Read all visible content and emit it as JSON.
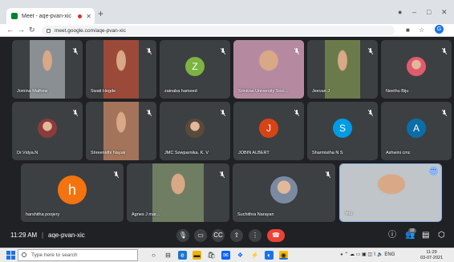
{
  "browser": {
    "tab_title": "Meet - aqe-pvan-xic",
    "new_tab_symbol": "+",
    "url": "meet.google.com/aqe-pvan-xic",
    "profile_initial": "G"
  },
  "participants": [
    {
      "name": "Jomina Mathew",
      "kind": "photo",
      "bg": "#8a8f93"
    },
    {
      "name": "Swati Hegde",
      "kind": "photo",
      "bg": "#9b4a3a"
    },
    {
      "name": "zainaba hameed",
      "kind": "initial",
      "initial": "Z",
      "color": "#7cb342"
    },
    {
      "name": "Srinivas University Soci...",
      "kind": "photo",
      "bg": "#b58aa0"
    },
    {
      "name": "Jeevan J",
      "kind": "photo",
      "bg": "#6b7a4a"
    },
    {
      "name": "Neethu Biju",
      "kind": "photo-circle",
      "bg": "#e05b6e"
    },
    {
      "name": "Dr.Vidya.N",
      "kind": "photo-circle",
      "bg": "#8b3b3b"
    },
    {
      "name": "Shreenidhi Nayak",
      "kind": "photo",
      "bg": "#a3745a"
    },
    {
      "name": "JMC Sowparnika. K. V",
      "kind": "photo-circle",
      "bg": "#5a4a3a"
    },
    {
      "name": "JOBIN ALBERT",
      "kind": "initial",
      "initial": "J",
      "color": "#d84315"
    },
    {
      "name": "Sharmistha N S",
      "kind": "initial",
      "initial": "S",
      "color": "#039be5"
    },
    {
      "name": "Ashwini cmc",
      "kind": "initial",
      "initial": "A",
      "color": "#0b6ea8"
    },
    {
      "name": "harshitha poojery",
      "kind": "initial",
      "initial": "h",
      "color": "#f4730e"
    },
    {
      "name": "Agnes J mar...",
      "kind": "photo",
      "bg": "#6f7d63"
    },
    {
      "name": "Suchithra Narayan",
      "kind": "photo-circle",
      "bg": "#7a8aa0"
    },
    {
      "name": "You",
      "kind": "photo",
      "bg": "#bfc5c8"
    }
  ],
  "controls": {
    "time": "11:29 AM",
    "separator": "|",
    "meeting_code": "aqe-pvan-xic",
    "participant_count": "16",
    "buttons": [
      "mic-icon",
      "camera-icon",
      "captions-icon",
      "present-icon",
      "more-icon",
      "end-call-icon"
    ],
    "end_color": "#ea4335"
  },
  "taskbar": {
    "search_placeholder": "Type here to search",
    "tray_lang": "ENG",
    "clock_time": "11:29",
    "clock_date": "03-07-2021"
  }
}
